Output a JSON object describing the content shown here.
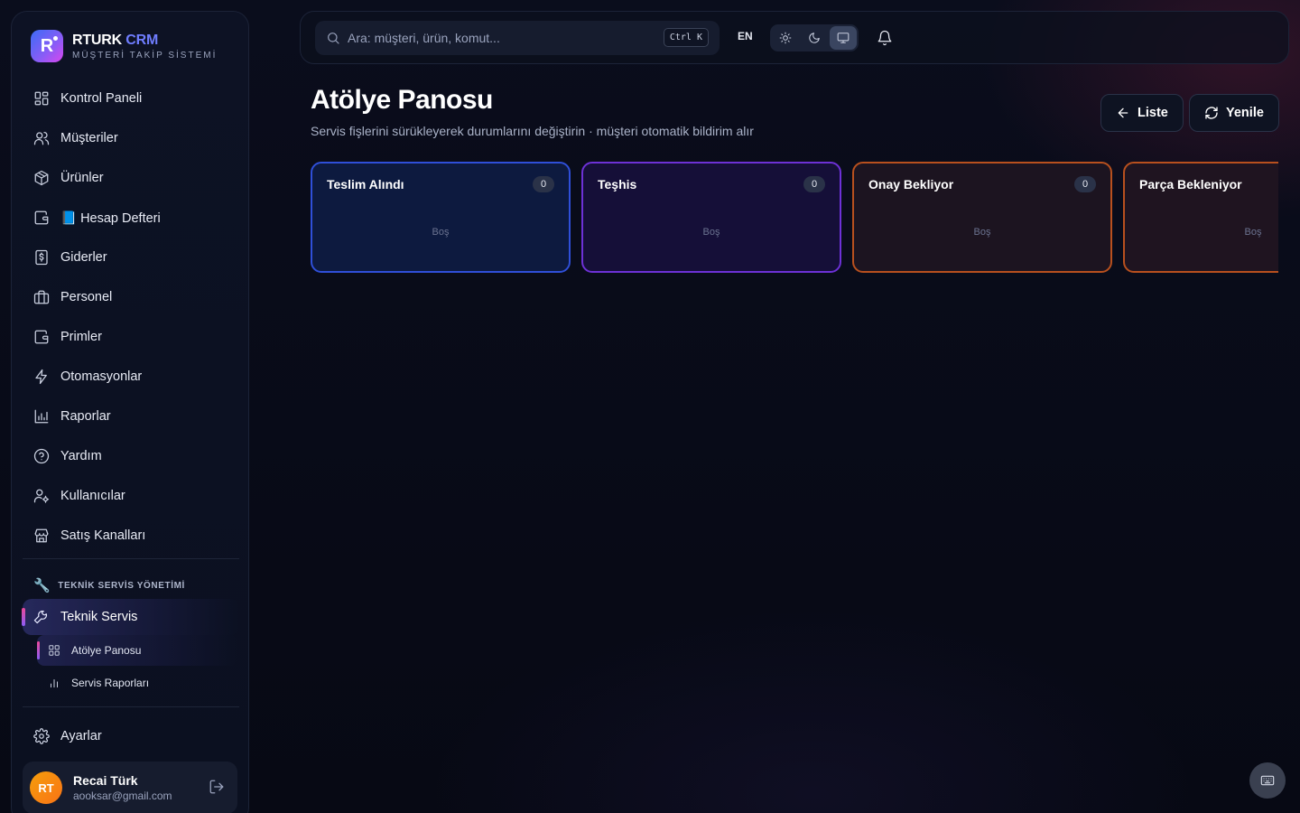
{
  "brand": {
    "name": "RTURK",
    "name_accent": "CRM",
    "subtitle": "MÜŞTERİ TAKİP SİSTEMİ",
    "logo_letter": "R"
  },
  "sidebar": {
    "items": [
      {
        "label": "Kontrol Paneli",
        "icon": "dashboard-icon"
      },
      {
        "label": "Müşteriler",
        "icon": "users-icon"
      },
      {
        "label": "Ürünler",
        "icon": "package-icon"
      },
      {
        "label": "📘 Hesap Defteri",
        "icon": "wallet-icon"
      },
      {
        "label": "Giderler",
        "icon": "receipt-icon"
      },
      {
        "label": "Personel",
        "icon": "briefcase-icon"
      },
      {
        "label": "Primler",
        "icon": "wallet-icon"
      },
      {
        "label": "Otomasyonlar",
        "icon": "zap-icon"
      },
      {
        "label": "Raporlar",
        "icon": "bar-chart-icon"
      },
      {
        "label": "Yardım",
        "icon": "help-circle-icon"
      },
      {
        "label": "Kullanıcılar",
        "icon": "user-cog-icon"
      },
      {
        "label": "Satış Kanalları",
        "icon": "store-icon"
      }
    ],
    "section_title": "TEKNİK SERVİS YÖNETİMİ",
    "section_emoji": "🔧",
    "active_item": "Teknik Servis",
    "sub_items": [
      "Atölye Panosu",
      "Servis Raporları"
    ],
    "settings": "Ayarlar",
    "user": {
      "initials": "RT",
      "name": "Recai Türk",
      "email": "aooksar@gmail.com"
    }
  },
  "topbar": {
    "search_placeholder": "Ara: müşteri, ürün, komut...",
    "shortcut": "Ctrl K",
    "language": "EN",
    "theme_active": "system"
  },
  "main": {
    "title": "Atölye Panosu",
    "subtitle": "Servis fişlerini sürükleyerek durumlarını değiştirin · müşteri otomatik bildirim alır",
    "buttons": {
      "list": "Liste",
      "refresh": "Yenile"
    },
    "columns": [
      {
        "title": "Teslim Alındı",
        "count": "0",
        "empty": "Boş",
        "color": "#2f4fd8",
        "bg": "#0d1a3f"
      },
      {
        "title": "Teşhis",
        "count": "0",
        "empty": "Boş",
        "color": "#6d31d6",
        "bg": "#150f38"
      },
      {
        "title": "Onay Bekliyor",
        "count": "0",
        "empty": "Boş",
        "color": "#b8501e",
        "bg": "#1c1420"
      },
      {
        "title": "Parça Bekleniyor",
        "count": "",
        "empty": "Boş",
        "color": "#b8501e",
        "bg": "#1f1420"
      }
    ]
  }
}
